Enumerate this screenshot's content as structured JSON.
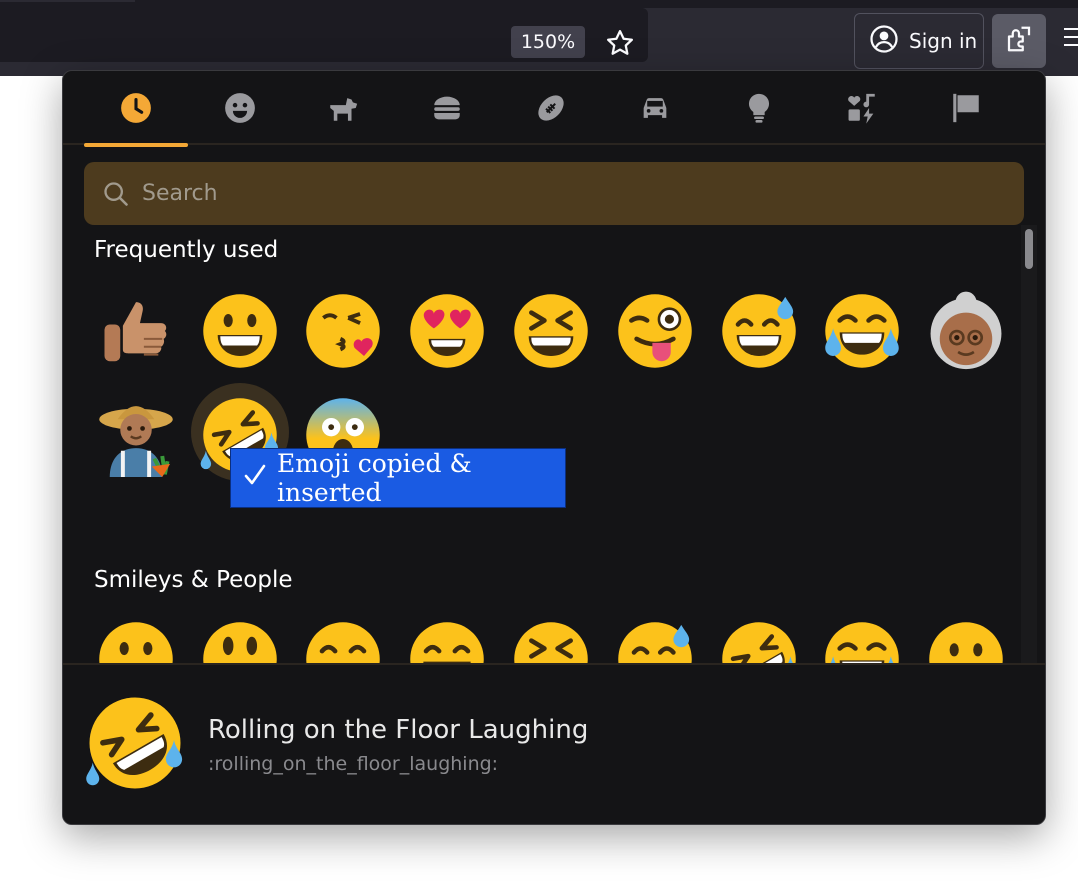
{
  "browser": {
    "zoom_level": "150%",
    "bookmark_icon": "star-icon",
    "sign_in_label": "Sign in",
    "account_icon": "account-circle-icon",
    "extension_icon": "puzzle-icon",
    "menu_icon": "hamburger-menu-icon"
  },
  "picker": {
    "accent_color": "#f4a836",
    "categories": [
      {
        "name": "recent",
        "icon": "clock-icon",
        "active": true
      },
      {
        "name": "smileys",
        "icon": "smiley-icon"
      },
      {
        "name": "animals",
        "icon": "dog-icon"
      },
      {
        "name": "food",
        "icon": "burger-icon"
      },
      {
        "name": "activities",
        "icon": "football-icon"
      },
      {
        "name": "travel",
        "icon": "car-icon"
      },
      {
        "name": "objects",
        "icon": "lightbulb-icon"
      },
      {
        "name": "symbols",
        "icon": "symbols-icon"
      },
      {
        "name": "flags",
        "icon": "flag-icon"
      }
    ],
    "search_placeholder": "Search",
    "sections": {
      "frequent_title": "Frequently used",
      "frequent": [
        "thumbs-up",
        "grinning",
        "kissing-heart",
        "heart-eyes",
        "squinting-laugh",
        "winking-tongue",
        "grinning-sweat",
        "tears-of-joy",
        "old-woman",
        "farmer",
        "rofl",
        "screaming"
      ],
      "smileys_title": "Smileys & People",
      "smileys": [
        "grinning",
        "grinning-big-eyes",
        "grinning-smiling-eyes",
        "beaming",
        "squinting-laugh",
        "grinning-sweat",
        "rofl",
        "tears-of-joy",
        "slightly-smiling"
      ]
    },
    "toast": "Emoji copied & inserted",
    "footer": {
      "name": "Rolling on the Floor Laughing",
      "shortcode": ":rolling_on_the_floor_laughing:"
    }
  }
}
